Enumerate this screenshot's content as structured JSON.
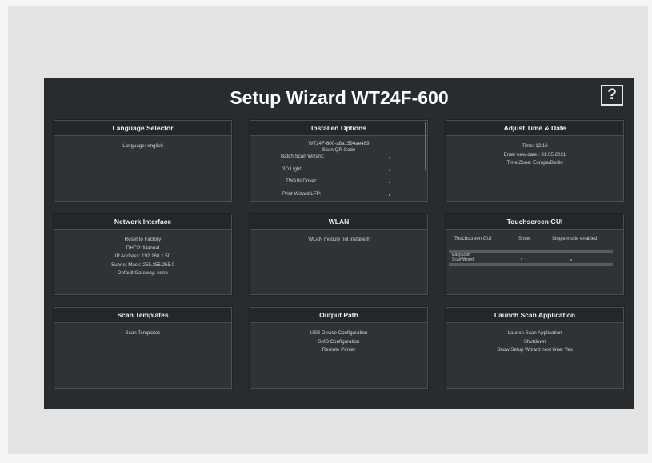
{
  "title": "Setup Wizard WT24F-600",
  "help_label": "?",
  "panels": {
    "language": {
      "title": "Language Selector",
      "language": "Language: english"
    },
    "options": {
      "title": "Installed Options",
      "serial": "WT24F-600-a8a1594ae489",
      "scan_qr": "Scan QR Code",
      "items": [
        "Batch Scan Wizard:",
        "3D Light:",
        "TWAIN Driver:",
        "Print Wizard LFP:"
      ]
    },
    "time": {
      "title": "Adjust Time & Date",
      "time": "Time: 12:16",
      "date": "Enter new date : 31.05.2021",
      "zone": "Time Zone: Europe/Berlin"
    },
    "network": {
      "title": "Network Interface",
      "reset": "Reset to Factory",
      "dhcp": "DHCP: Manual",
      "ip": "IP Address: 192.168.1.50",
      "mask": "Subnet Mask: 255.255.255.0",
      "gateway": "Default Gateway: none"
    },
    "wlan": {
      "title": "WLAN",
      "status": "WLAN module not installed!"
    },
    "touch": {
      "title": "Touchscreen GUI",
      "col_gui": "Touchscreen GUI",
      "col_show": "Show",
      "col_single": "Single mode enabled",
      "row1": "EasyScan",
      "row2": "ScanWizard"
    },
    "templates": {
      "title": "Scan Templates",
      "item": "Scan Templates"
    },
    "output": {
      "title": "Output Path",
      "usb": "USB Device Configuration",
      "smb": "SMB Configuration",
      "printer": "Remote Printer"
    },
    "launch": {
      "title": "Launch Scan Application",
      "launch": "Launch Scan Application",
      "shutdown": "Shutdown",
      "show_next": "Show Setup Wizard next time: Yes"
    }
  },
  "colors": {
    "screen_bg": "#292c2f",
    "panel_bg": "#303336",
    "header_bg": "#24272a",
    "check_green": "#3fa04a"
  }
}
